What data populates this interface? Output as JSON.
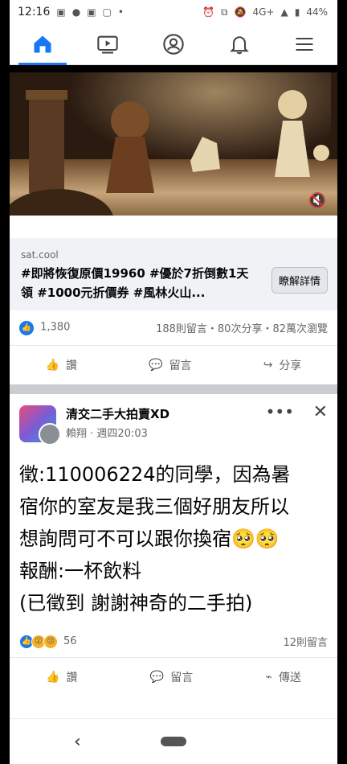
{
  "status": {
    "time": "12:16",
    "network": "4G+",
    "battery": "44%"
  },
  "nav": {
    "items": [
      "home-icon",
      "video-icon",
      "profile-icon",
      "bell-icon",
      "menu-icon"
    ]
  },
  "ad": {
    "domain": "sat.cool",
    "text": "#即將恢復原價19960 #優於7折倒數1天 領 #1000元折價券 #風林火山...",
    "cta": "瞭解詳情",
    "likes": "1,380",
    "engagement": "188則留言・80次分享・82萬次瀏覽"
  },
  "actions": {
    "like": "讚",
    "comment": "留言",
    "share": "分享",
    "send": "傳送"
  },
  "post": {
    "group": "清交二手大拍賣XD",
    "author": "賴翔",
    "time": "週四20:03",
    "body": [
      "徵:110006224的同學，因為暑",
      "宿你的室友是我三個好朋友所以",
      "想詢問可不可以跟你換宿🥺🥺",
      "報酬:一杯飲料",
      "(已徵到 謝謝神奇的二手拍)"
    ],
    "reactions": "56",
    "comments": "12則留言"
  },
  "colors": {
    "brand": "#1877f2"
  }
}
